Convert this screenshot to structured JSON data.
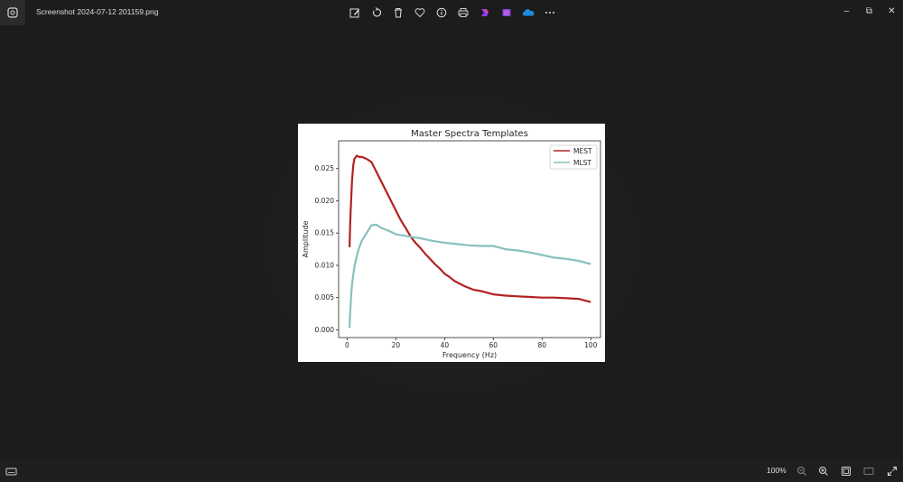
{
  "window": {
    "file_name": "Screenshot 2024-07-12 201159.png",
    "toolbar_icons": [
      "edit-image-icon",
      "rotate-icon",
      "delete-icon",
      "favorite-icon",
      "info-icon",
      "print-icon",
      "clipchamp-icon",
      "designer-icon",
      "onedrive-icon",
      "more-icon"
    ],
    "minimize_glyph": "–",
    "maximize_glyph": "⧉",
    "close_glyph": "✕"
  },
  "bottom_bar": {
    "zoom_level": "100%"
  },
  "chart_data": {
    "type": "line",
    "title": "Master Spectra Templates",
    "xlabel": "Frequency (Hz)",
    "ylabel": "Amplitude",
    "xlim": [
      -3.5,
      104
    ],
    "ylim": [
      -0.0012,
      0.0293
    ],
    "xticks": [
      0,
      20,
      40,
      60,
      80,
      100
    ],
    "yticks": [
      0.0,
      0.005,
      0.01,
      0.015,
      0.02,
      0.025
    ],
    "xtick_labels": [
      "0",
      "20",
      "40",
      "60",
      "80",
      "100"
    ],
    "ytick_labels": [
      "0.000",
      "0.005",
      "0.010",
      "0.015",
      "0.020",
      "0.025"
    ],
    "legend_position": "top-right",
    "series": [
      {
        "name": "MEST",
        "color": "#b22222",
        "x": [
          1,
          1.2,
          1.5,
          2,
          2.5,
          3,
          4,
          5,
          6,
          8,
          10,
          12,
          14,
          16,
          18,
          20,
          22,
          24,
          26,
          28,
          30,
          32,
          34,
          36,
          38,
          40,
          42,
          44,
          46,
          48,
          50,
          52,
          55,
          60,
          65,
          70,
          75,
          80,
          85,
          90,
          95,
          100
        ],
        "values": [
          0.0128,
          0.016,
          0.019,
          0.023,
          0.0255,
          0.0265,
          0.027,
          0.0268,
          0.0268,
          0.0265,
          0.026,
          0.0245,
          0.023,
          0.0215,
          0.02,
          0.0185,
          0.017,
          0.0158,
          0.0145,
          0.0135,
          0.0127,
          0.0118,
          0.011,
          0.0102,
          0.0095,
          0.0087,
          0.0082,
          0.0076,
          0.0072,
          0.0068,
          0.0065,
          0.0062,
          0.006,
          0.0055,
          0.0053,
          0.0052,
          0.0051,
          0.005,
          0.005,
          0.0049,
          0.0048,
          0.0043
        ]
      },
      {
        "name": "MLST",
        "color": "#87c1bd",
        "x": [
          1,
          1.3,
          1.7,
          2,
          2.5,
          3,
          4,
          5,
          6,
          8,
          10,
          12,
          14,
          16,
          18,
          20,
          25,
          30,
          35,
          40,
          45,
          50,
          55,
          60,
          65,
          70,
          75,
          80,
          85,
          90,
          95,
          100
        ],
        "values": [
          0.0003,
          0.003,
          0.0055,
          0.007,
          0.0085,
          0.0098,
          0.0115,
          0.0128,
          0.0138,
          0.015,
          0.0162,
          0.0163,
          0.0158,
          0.0155,
          0.0152,
          0.0148,
          0.0145,
          0.0142,
          0.0138,
          0.0135,
          0.0133,
          0.0131,
          0.013,
          0.013,
          0.0125,
          0.0123,
          0.012,
          0.0116,
          0.0112,
          0.011,
          0.0107,
          0.0102
        ]
      }
    ]
  }
}
